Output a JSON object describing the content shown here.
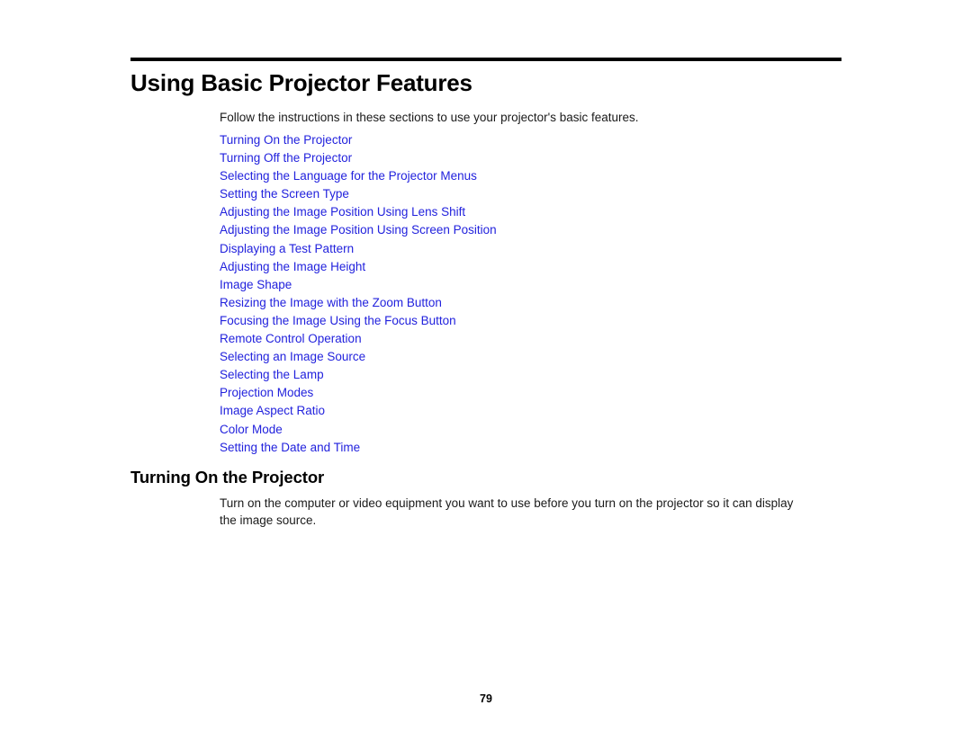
{
  "document": {
    "title": "Using Basic Projector Features",
    "intro": "Follow the instructions in these sections to use your projector's basic features.",
    "page_number": "79"
  },
  "links": [
    {
      "label": "Turning On the Projector"
    },
    {
      "label": "Turning Off the Projector"
    },
    {
      "label": "Selecting the Language for the Projector Menus"
    },
    {
      "label": "Setting the Screen Type"
    },
    {
      "label": "Adjusting the Image Position Using Lens Shift"
    },
    {
      "label": "Adjusting the Image Position Using Screen Position"
    },
    {
      "label": "Displaying a Test Pattern"
    },
    {
      "label": "Adjusting the Image Height"
    },
    {
      "label": "Image Shape"
    },
    {
      "label": "Resizing the Image with the Zoom Button"
    },
    {
      "label": "Focusing the Image Using the Focus Button"
    },
    {
      "label": "Remote Control Operation"
    },
    {
      "label": "Selecting an Image Source"
    },
    {
      "label": "Selecting the Lamp"
    },
    {
      "label": "Projection Modes"
    },
    {
      "label": "Image Aspect Ratio"
    },
    {
      "label": "Color Mode"
    },
    {
      "label": "Setting the Date and Time"
    }
  ],
  "section": {
    "heading": "Turning On the Projector",
    "body": "Turn on the computer or video equipment you want to use before you turn on the projector so it can display the image source."
  },
  "colors": {
    "link": "#2222dd",
    "text": "#1a1a1a",
    "rule": "#000000",
    "background": "#ffffff"
  }
}
